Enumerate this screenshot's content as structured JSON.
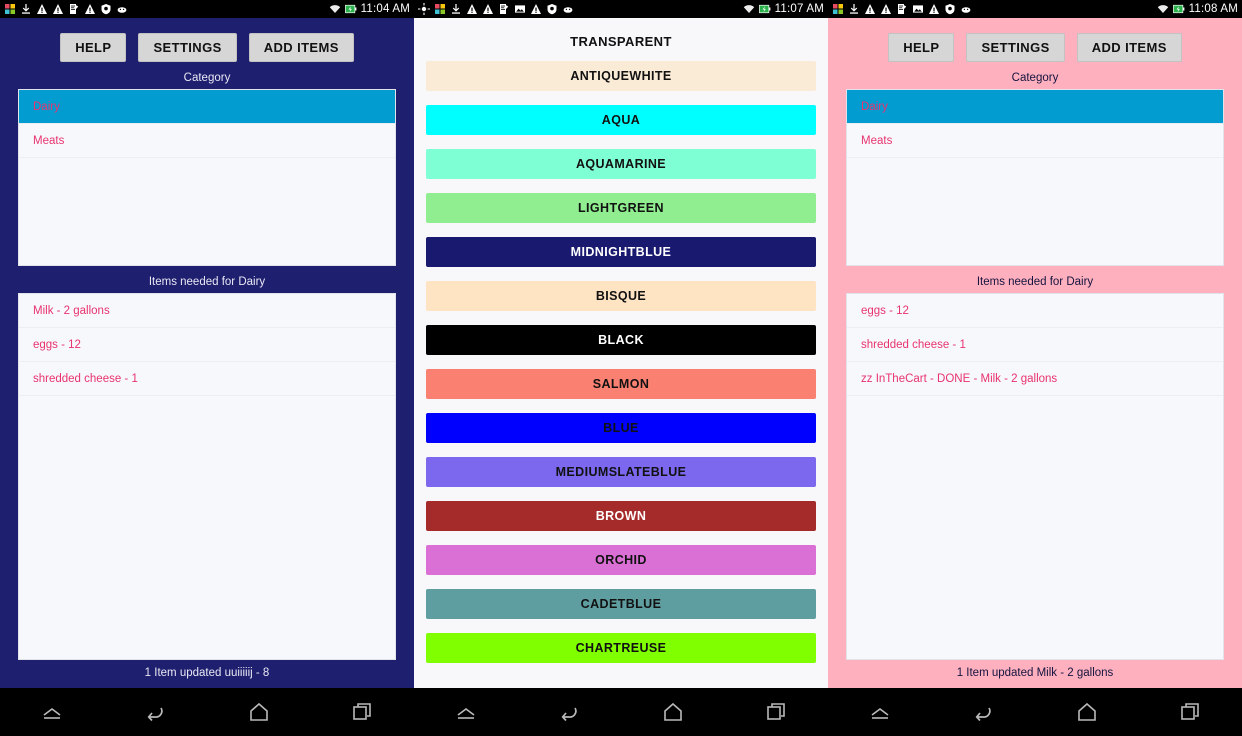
{
  "panels": [
    {
      "id": "panel-navy",
      "theme": "navy",
      "statusbar": {
        "time": "11:04 AM",
        "icons": [
          "app-icon",
          "download-icon",
          "warning-icon",
          "warning-icon",
          "note-edit-icon",
          "warning-icon",
          "shield-icon",
          "android-icon"
        ],
        "right_icons": [
          "wifi-icon",
          "battery-charging-icon"
        ]
      },
      "buttons": [
        "HELP",
        "SETTINGS",
        "ADD ITEMS"
      ],
      "category_label": "Category",
      "categories": [
        {
          "label": "Dairy",
          "selected": true
        },
        {
          "label": "Meats",
          "selected": false
        }
      ],
      "items_label": "Items needed for Dairy",
      "items": [
        "Milk - 2 gallons",
        "eggs - 12",
        "shredded cheese - 1"
      ],
      "status": "1 Item updated uuiiiiij - 8"
    },
    {
      "id": "panel-pink",
      "theme": "pink",
      "statusbar": {
        "time": "11:08 AM",
        "icons": [
          "app-icon",
          "download-icon",
          "warning-icon",
          "warning-icon",
          "note-edit-icon",
          "image-icon",
          "warning-icon",
          "shield-icon",
          "android-icon"
        ],
        "right_icons": [
          "wifi-icon",
          "battery-charging-icon"
        ]
      },
      "buttons": [
        "HELP",
        "SETTINGS",
        "ADD ITEMS"
      ],
      "category_label": "Category",
      "categories": [
        {
          "label": "Dairy",
          "selected": true
        },
        {
          "label": "Meats",
          "selected": false
        }
      ],
      "items_label": "Items needed for Dairy",
      "items": [
        "eggs - 12",
        "shredded cheese - 1",
        "zz InTheCart - DONE - Milk - 2 gallons"
      ],
      "status": "1 Item updated Milk - 2 gallons"
    }
  ],
  "middle": {
    "id": "panel-colors",
    "statusbar": {
      "time": "11:07 AM",
      "icons": [
        "gps-icon",
        "app-icon",
        "download-icon",
        "warning-icon",
        "warning-icon",
        "note-edit-icon",
        "image-icon",
        "warning-icon",
        "shield-icon",
        "android-icon"
      ],
      "right_icons": [
        "wifi-icon",
        "battery-charging-icon"
      ]
    },
    "title": "TRANSPARENT",
    "colors": [
      {
        "label": "ANTIQUEWHITE",
        "bg": "#faebd7",
        "fg": "#111111"
      },
      {
        "label": "AQUA",
        "bg": "#00ffff",
        "fg": "#111111"
      },
      {
        "label": "AQUAMARINE",
        "bg": "#7fffd4",
        "fg": "#111111"
      },
      {
        "label": "LIGHTGREEN",
        "bg": "#90ee90",
        "fg": "#111111"
      },
      {
        "label": "MIDNIGHTBLUE",
        "bg": "#191970",
        "fg": "#ffffff"
      },
      {
        "label": "BISQUE",
        "bg": "#ffe4c4",
        "fg": "#111111"
      },
      {
        "label": "BLACK",
        "bg": "#000000",
        "fg": "#ffffff"
      },
      {
        "label": "SALMON",
        "bg": "#fa8072",
        "fg": "#111111"
      },
      {
        "label": "BLUE",
        "bg": "#0000ff",
        "fg": "#111111"
      },
      {
        "label": "MEDIUMSLATEBLUE",
        "bg": "#7b68ee",
        "fg": "#111111"
      },
      {
        "label": "BROWN",
        "bg": "#a52a2a",
        "fg": "#ffffff"
      },
      {
        "label": "ORCHID",
        "bg": "#da70d6",
        "fg": "#111111"
      },
      {
        "label": "CADETBLUE",
        "bg": "#5f9ea0",
        "fg": "#111111"
      },
      {
        "label": "CHARTREUSE",
        "bg": "#7fff00",
        "fg": "#111111"
      }
    ]
  },
  "navbar": {
    "buttons": [
      "menu-up-icon",
      "back-icon",
      "home-icon",
      "recents-icon"
    ]
  },
  "colors": {
    "navy_bg": "#1f1f70",
    "pink_bg": "#ffb0bf",
    "white_bg": "#f8f8fb",
    "selected_row": "#029cd0",
    "row_text": "#e8336e",
    "button_bg": "#d6d6d6"
  }
}
